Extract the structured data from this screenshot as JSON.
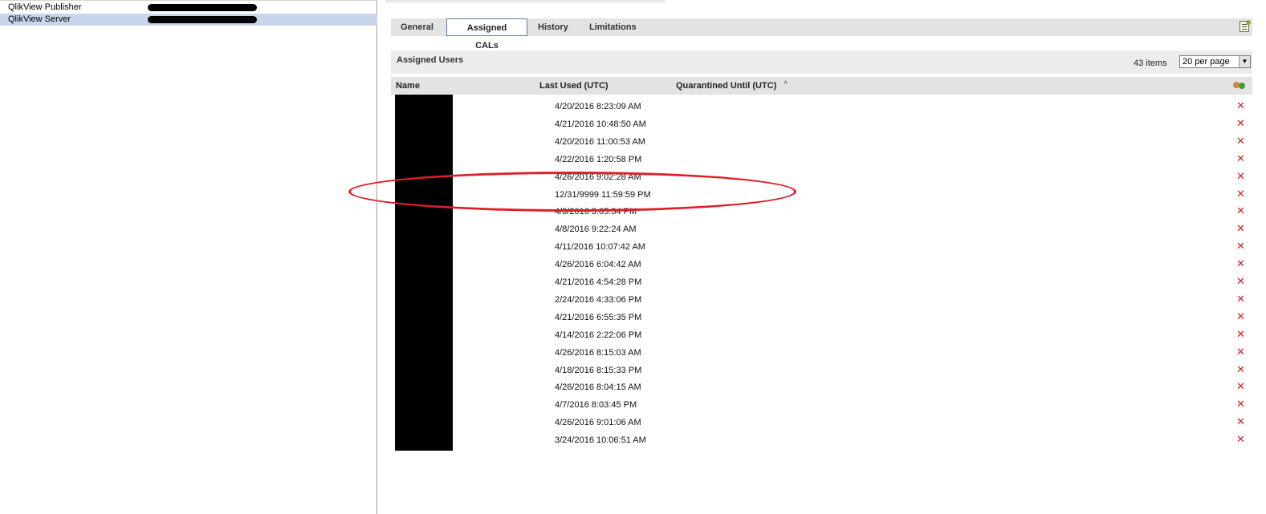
{
  "left_pane": {
    "items": [
      {
        "name": "QlikView Publisher"
      },
      {
        "name": "QlikView Server"
      }
    ]
  },
  "tabs": [
    {
      "label": "General"
    },
    {
      "label": "Assigned CALs"
    },
    {
      "label": "History"
    },
    {
      "label": "Limitations"
    }
  ],
  "section": {
    "title": "Assigned Users",
    "items_count": "43 items",
    "per_page": "20 per page"
  },
  "columns": {
    "name": "Name",
    "last_used": "Last Used (UTC)",
    "quarantined": "Quarantined Until (UTC)",
    "sort_indicator": "˄"
  },
  "rows": [
    {
      "last_used": "4/20/2016 8:23:09 AM"
    },
    {
      "last_used": "4/21/2016 10:48:50 AM"
    },
    {
      "last_used": "4/20/2016 11:00:53 AM"
    },
    {
      "last_used": "4/22/2016 1:20:58 PM"
    },
    {
      "last_used": "4/26/2016 9:02:28 AM"
    },
    {
      "last_used": "12/31/9999 11:59:59 PM"
    },
    {
      "last_used": "4/8/2016 3:05:34 PM"
    },
    {
      "last_used": "4/8/2016 9:22:24 AM"
    },
    {
      "last_used": "4/11/2016 10:07:42 AM"
    },
    {
      "last_used": "4/26/2016 6:04:42 AM"
    },
    {
      "last_used": "4/21/2016 4:54:28 PM"
    },
    {
      "last_used": "2/24/2016 4:33:06 PM"
    },
    {
      "last_used": "4/21/2016 6:55:35 PM"
    },
    {
      "last_used": "4/14/2016 2:22:06 PM"
    },
    {
      "last_used": "4/26/2016 8:15:03 AM"
    },
    {
      "last_used": "4/18/2016 8:15:33 PM"
    },
    {
      "last_used": "4/26/2016 8:04:15 AM"
    },
    {
      "last_used": "4/7/2016 8:03:45 PM"
    },
    {
      "last_used": "4/26/2016 9:01:06 AM"
    },
    {
      "last_used": "3/24/2016 10:06:51 AM"
    }
  ],
  "delete_glyph": "✕",
  "colors": {
    "selected_row": "#c8d5eb",
    "tab_active_border": "#5d7fb0",
    "annotation_red": "#dd1f27",
    "delete_red": "#d02020"
  },
  "icons": {
    "export": "export-document-icon",
    "users": "users-group-icon",
    "delete": "delete-x-icon"
  }
}
